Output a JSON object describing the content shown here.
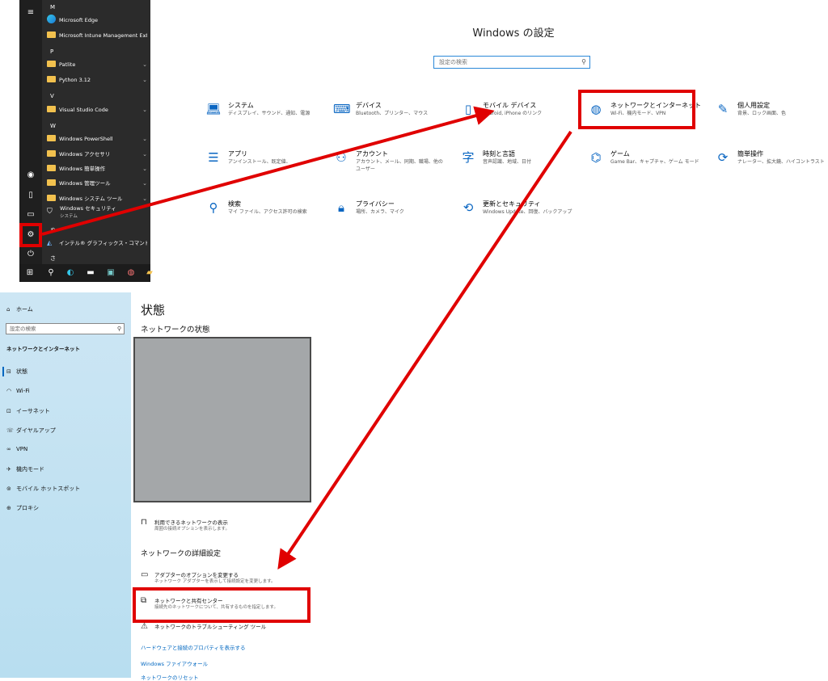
{
  "start_menu": {
    "letters": [
      "M",
      "P",
      "V",
      "W"
    ],
    "items": [
      {
        "label": "Microsoft Edge",
        "icon": "edge-icon",
        "chevron": false
      },
      {
        "label": "Microsoft Intune Management Ext...",
        "icon": "folder-icon",
        "chevron": true
      },
      {
        "label": "Patlite",
        "icon": "folder-icon",
        "chevron": true
      },
      {
        "label": "Python 3.12",
        "icon": "folder-icon",
        "chevron": true
      },
      {
        "label": "Visual Studio Code",
        "icon": "folder-icon",
        "chevron": true
      },
      {
        "label": "Windows PowerShell",
        "icon": "folder-icon",
        "chevron": true
      },
      {
        "label": "Windows アクセサリ",
        "icon": "folder-icon",
        "chevron": true
      },
      {
        "label": "Windows 簡単操作",
        "icon": "folder-icon",
        "chevron": true
      },
      {
        "label": "Windows 管理ツール",
        "icon": "folder-icon",
        "chevron": true
      },
      {
        "label": "Windows システム ツール",
        "icon": "folder-icon",
        "chevron": true
      },
      {
        "label": "Windows セキュリティ",
        "sub": "システム",
        "icon": "shield-icon",
        "chevron": false
      },
      {
        "label": "インテル® グラフィックス・コマンド・センター",
        "icon": "intel-icon",
        "chevron": false
      }
    ],
    "extra_letter_1": "ゃ",
    "extra_letter_2": "さ"
  },
  "settings": {
    "title": "Windows の設定",
    "search_placeholder": "設定の検索",
    "tiles": [
      {
        "title": "システム",
        "desc": "ディスプレイ、サウンド、通知、電源",
        "icon": "laptop-icon"
      },
      {
        "title": "デバイス",
        "desc": "Bluetooth、プリンター、マウス",
        "icon": "keyboard-icon"
      },
      {
        "title": "モバイル デバイス",
        "desc": "Android, iPhone のリンク",
        "icon": "phone-icon"
      },
      {
        "title": "ネットワークとインターネット",
        "desc": "Wi-Fi、機内モード、VPN",
        "icon": "globe-icon"
      },
      {
        "title": "個人用設定",
        "desc": "背景、ロック画面、色",
        "icon": "brush-icon"
      },
      {
        "title": "アプリ",
        "desc": "アンインストール、既定値、",
        "icon": "apps-icon"
      },
      {
        "title": "アカウント",
        "desc": "アカウント、メール、同期、職場、他のユーザー",
        "icon": "account-icon"
      },
      {
        "title": "時刻と言語",
        "desc": "音声認識、地域、日付",
        "icon": "time-language-icon"
      },
      {
        "title": "ゲーム",
        "desc": "Game Bar、キャプチャ、ゲーム モード",
        "icon": "gamepad-icon"
      },
      {
        "title": "簡単操作",
        "desc": "ナレーター、拡大鏡、ハイコントラスト",
        "icon": "ease-of-access-icon"
      },
      {
        "title": "検索",
        "desc": "マイ ファイル、アクセス許可の検索",
        "icon": "search-icon"
      },
      {
        "title": "プライバシー",
        "desc": "場所、カメラ、マイク",
        "icon": "lock-icon"
      },
      {
        "title": "更新とセキュリティ",
        "desc": "Windows Update、回復、バックアップ",
        "icon": "update-icon"
      }
    ]
  },
  "network": {
    "sidebar": {
      "home": "ホーム",
      "search_placeholder": "設定の検索",
      "section": "ネットワークとインターネット",
      "items": [
        {
          "label": "状態",
          "icon": "status-icon"
        },
        {
          "label": "Wi-Fi",
          "icon": "wifi-icon"
        },
        {
          "label": "イーサネット",
          "icon": "ethernet-icon"
        },
        {
          "label": "ダイヤルアップ",
          "icon": "dialup-icon"
        },
        {
          "label": "VPN",
          "icon": "vpn-icon"
        },
        {
          "label": "機内モード",
          "icon": "airplane-icon"
        },
        {
          "label": "モバイル ホットスポット",
          "icon": "hotspot-icon"
        },
        {
          "label": "プロキシ",
          "icon": "proxy-icon"
        }
      ]
    },
    "title": "状態",
    "subtitle": "ネットワークの状態",
    "rows": [
      {
        "title": "利用できるネットワークの表示",
        "desc": "周囲の接続オプションを表示します。"
      }
    ],
    "advanced_title": "ネットワークの詳細設定",
    "advanced_rows": [
      {
        "title": "アダプターのオプションを変更する",
        "desc": "ネットワーク アダプターを表示して接続設定を変更します。"
      },
      {
        "title": "ネットワークと共有センター",
        "desc": "接続先のネットワークについて、共有するものを指定します。"
      },
      {
        "title": "ネットワークのトラブルシューティング ツール",
        "desc": ""
      }
    ],
    "links": [
      "ハードウェアと接続のプロパティを表示する",
      "Windows ファイアウォール",
      "ネットワークのリセット"
    ]
  },
  "colors": {
    "highlight": "#e00000",
    "accent": "#0067c0",
    "tile_icon": "#0a66c2"
  }
}
